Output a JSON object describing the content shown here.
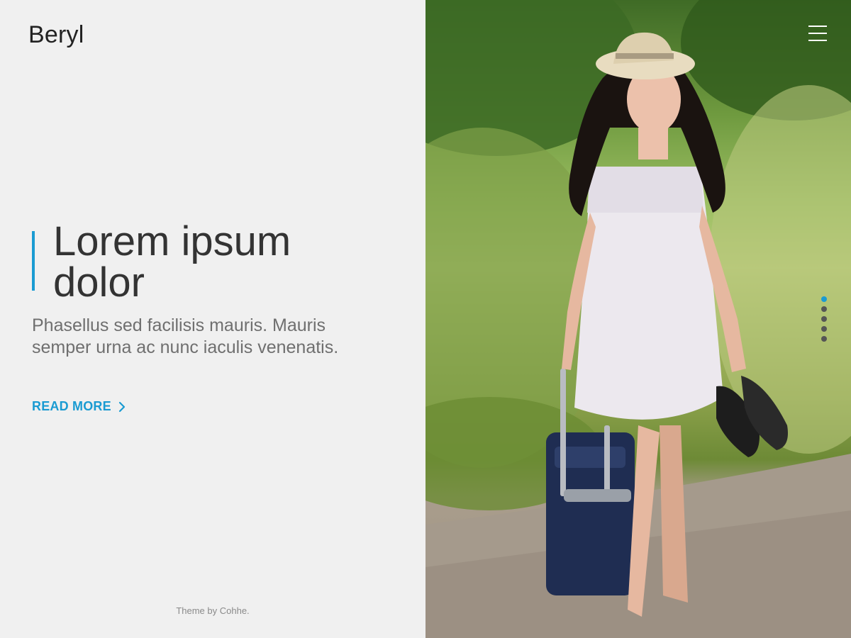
{
  "brand": {
    "name": "Beryl"
  },
  "hero": {
    "headline_line1": "Lorem ipsum",
    "headline_line2": "dolor",
    "subtitle": "Phasellus sed facilisis mauris. Mauris semper urna ac nunc iaculis venenatis.",
    "cta_label": "READ MORE"
  },
  "footer": {
    "credit": "Theme by Cohhe."
  },
  "nav": {
    "menu_icon": "hamburger-menu-icon"
  },
  "slider": {
    "count": 5,
    "active_index": 0
  },
  "colors": {
    "accent": "#1a9bd2",
    "text_dark": "#333333",
    "text_muted": "#6f6f6f",
    "background": "#f0f0f0"
  }
}
